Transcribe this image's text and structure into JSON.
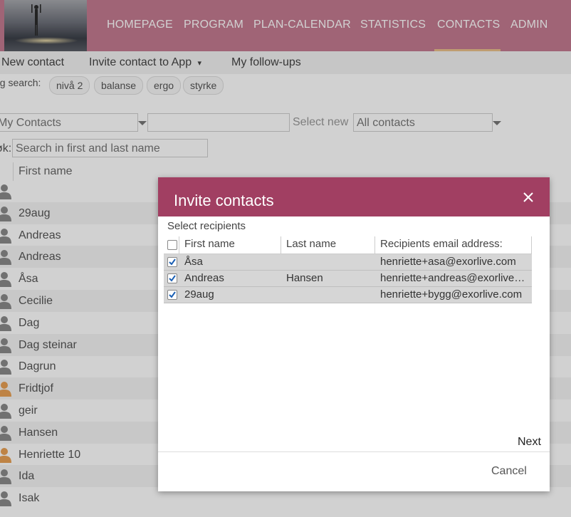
{
  "nav": {
    "items": [
      "HOMEPAGE",
      "PROGRAM",
      "PLAN-CALENDAR",
      "STATISTICS",
      "CONTACTS",
      "ADMIN"
    ],
    "active": "CONTACTS",
    "accent": "#c47b90",
    "underline_color": "#e9c08a"
  },
  "subnav": {
    "new_contact": "New contact",
    "invite": "Invite contact to App",
    "invite_caret": "▾",
    "followups": "My follow-ups"
  },
  "tags": {
    "label": "ag search:",
    "items": [
      "nivå 2",
      "balanse",
      "ergo",
      "styrke"
    ]
  },
  "filters": {
    "my_contacts": "My Contacts",
    "blank": "",
    "select_new": "Select new",
    "all_contacts": "All contacts"
  },
  "search": {
    "label": "øk:",
    "placeholder": "Search in first and last name"
  },
  "list": {
    "header_first_name": "First name",
    "rows": [
      "",
      "29aug",
      "Andreas",
      "Andreas",
      "Åsa",
      "Cecilie",
      "Dag",
      "Dag steinar",
      "Dagrun",
      "Fridtjof",
      "geir",
      "Hansen",
      "Henriette 10",
      "Ida",
      "Isak"
    ],
    "orange_rows": [
      "Fridtjof",
      "Henriette 10"
    ],
    "icon": "person-icon"
  },
  "dialog": {
    "title": "Invite contacts",
    "close_icon": "close-icon",
    "header_color": "#a13f62",
    "select_recipients": "Select recipients",
    "columns": {
      "first_name": "First name",
      "last_name": "Last name",
      "email": "Recipients email address:"
    },
    "recipients": [
      {
        "first": "Åsa",
        "last": "",
        "email": "henriette+asa@exorlive.com",
        "checked": true
      },
      {
        "first": "Andreas",
        "last": "Hansen",
        "email": "henriette+andreas@exorlive…",
        "checked": true
      },
      {
        "first": "29aug",
        "last": "",
        "email": "henriette+bygg@exorlive.com",
        "checked": true
      }
    ],
    "next": "Next",
    "cancel": "Cancel"
  }
}
